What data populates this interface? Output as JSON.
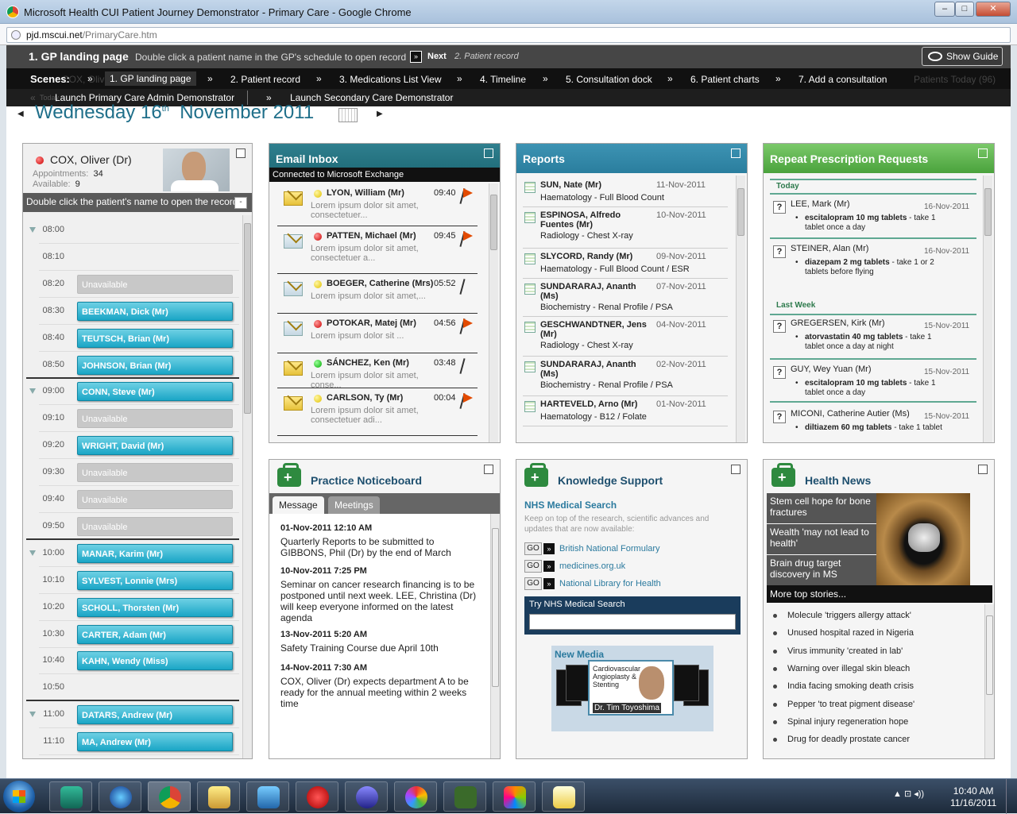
{
  "window": {
    "title": "Microsoft Health CUI Patient Journey Demonstrator - Primary Care - Google Chrome",
    "min": "–",
    "max": "□",
    "close": "✕"
  },
  "address": {
    "host": "pjd.mscui.net",
    "path": "/PrimaryCare.htm"
  },
  "guide": {
    "step": "1. GP landing page",
    "instruction": "Double click a patient name in the GP's schedule to open record",
    "next_arrow": "»",
    "next_label": "Next",
    "next_step": "2. Patient record",
    "show_guide": "Show Guide"
  },
  "scenes": {
    "label": "Scenes:",
    "ghost_left": "COX, Oliver",
    "ghost_right": "Patients Today (96)",
    "sep": "»",
    "items": [
      "1. GP landing page",
      "2. Patient record",
      "3. Medications List View",
      "4. Timeline",
      "5. Consultation dock",
      "6. Patient charts",
      "7. Add a consultation"
    ]
  },
  "demos": {
    "left": "Launch Primary Care Admin Demonstrator",
    "right": "Launch Secondary Care Demonstrator",
    "arrow": "«",
    "arrow_r": "»",
    "ghost": "Today"
  },
  "date": {
    "weekday": "Wednesday 16",
    "suffix": "th",
    "month_year": "November 2011",
    "prev": "◀",
    "next": "▶"
  },
  "schedule": {
    "doctor": "COX, Oliver (Dr)",
    "appointments_label": "Appointments:",
    "appointments": "34",
    "available_label": "Available:",
    "available": "9",
    "hint": "Double click the patient's name to open the record",
    "collapse": "-",
    "slots": [
      {
        "time": "08:00",
        "hour": true,
        "appt": "",
        "kind": ""
      },
      {
        "time": "08:10",
        "hour": false,
        "appt": "",
        "kind": ""
      },
      {
        "time": "08:20",
        "hour": false,
        "appt": "Unavailable",
        "kind": "un"
      },
      {
        "time": "08:30",
        "hour": false,
        "appt": "BEEKMAN, Dick (Mr)",
        "kind": "book"
      },
      {
        "time": "08:40",
        "hour": false,
        "appt": "TEUTSCH, Brian (Mr)",
        "kind": "book"
      },
      {
        "time": "08:50",
        "hour": false,
        "appt": "JOHNSON, Brian (Mr)",
        "kind": "book"
      },
      {
        "time": "09:00",
        "hour": true,
        "appt": "CONN, Steve (Mr)",
        "kind": "book"
      },
      {
        "time": "09:10",
        "hour": false,
        "appt": "Unavailable",
        "kind": "un"
      },
      {
        "time": "09:20",
        "hour": false,
        "appt": "WRIGHT, David (Mr)",
        "kind": "book"
      },
      {
        "time": "09:30",
        "hour": false,
        "appt": "Unavailable",
        "kind": "un"
      },
      {
        "time": "09:40",
        "hour": false,
        "appt": "Unavailable",
        "kind": "un"
      },
      {
        "time": "09:50",
        "hour": false,
        "appt": "Unavailable",
        "kind": "un"
      },
      {
        "time": "10:00",
        "hour": true,
        "appt": "MANAR, Karim (Mr)",
        "kind": "book"
      },
      {
        "time": "10:10",
        "hour": false,
        "appt": "SYLVEST, Lonnie (Mrs)",
        "kind": "book"
      },
      {
        "time": "10:20",
        "hour": false,
        "appt": "SCHOLL, Thorsten (Mr)",
        "kind": "book"
      },
      {
        "time": "10:30",
        "hour": false,
        "appt": "CARTER, Adam (Mr)",
        "kind": "book"
      },
      {
        "time": "10:40",
        "hour": false,
        "appt": "KAHN, Wendy (Miss)",
        "kind": "book"
      },
      {
        "time": "10:50",
        "hour": false,
        "appt": "",
        "kind": ""
      },
      {
        "time": "11:00",
        "hour": true,
        "appt": "DATARS, Andrew (Mr)",
        "kind": "book"
      },
      {
        "time": "11:10",
        "hour": false,
        "appt": "MA, Andrew (Mr)",
        "kind": "book"
      }
    ]
  },
  "email": {
    "title": "Email Inbox",
    "subtitle": "Connected to Microsoft Exchange",
    "items": [
      {
        "name": "LYON, William (Mr)",
        "time": "09:40",
        "body": "Lorem ipsum dolor sit amet, consectetuer...",
        "dot": "y",
        "flag": true,
        "open": false
      },
      {
        "name": "PATTEN, Michael (Mr)",
        "time": "09:45",
        "body": "Lorem ipsum dolor sit amet, consectetuer a...",
        "dot": "r",
        "flag": true,
        "open": true
      },
      {
        "name": "BOEGER, Catherine (Mrs)",
        "time": "05:52",
        "body": "Lorem ipsum dolor sit amet,...",
        "dot": "y",
        "flag": false,
        "open": true
      },
      {
        "name": "POTOKAR, Matej (Mr)",
        "time": "04:56",
        "body": "Lorem ipsum dolor sit ...",
        "dot": "r",
        "flag": true,
        "open": true
      },
      {
        "name": "SÁNCHEZ, Ken (Mr)",
        "time": "03:48",
        "body": "Lorem ipsum dolor sit amet, conse...",
        "dot": "g",
        "flag": false,
        "open": false
      },
      {
        "name": "CARLSON, Ty (Mr)",
        "time": "00:04",
        "body": "Lorem ipsum dolor sit amet, consectetuer adi...",
        "dot": "y",
        "flag": true,
        "open": false
      }
    ]
  },
  "reports": {
    "title": "Reports",
    "items": [
      {
        "name": "SUN, Nate (Mr)",
        "date": "11-Nov-2011",
        "desc": "Haematology - Full Blood Count",
        "lines": 1
      },
      {
        "name": "ESPINOSA, Alfredo Fuentes (Mr)",
        "date": "10-Nov-2011",
        "desc": "Radiology - Chest X-ray",
        "lines": 2
      },
      {
        "name": "SLYCORD, Randy (Mr)",
        "date": "09-Nov-2011",
        "desc": "Haematology - Full Blood Count / ESR",
        "lines": 1
      },
      {
        "name": "SUNDARARAJ, Ananth (Ms)",
        "date": "07-Nov-2011",
        "desc": "Biochemistry - Renal Profile / PSA",
        "lines": 2
      },
      {
        "name": "GESCHWANDTNER, Jens (Mr)",
        "date": "04-Nov-2011",
        "desc": "Radiology - Chest X-ray",
        "lines": 2
      },
      {
        "name": "SUNDARARAJ, Ananth (Ms)",
        "date": "02-Nov-2011",
        "desc": "Biochemistry - Renal Profile / PSA",
        "lines": 2
      },
      {
        "name": "HARTEVELD, Arno (Mr)",
        "date": "01-Nov-2011",
        "desc": "Haematology - B12 / Folate",
        "lines": 1
      }
    ]
  },
  "repeat": {
    "title": "Repeat Prescription Requests",
    "today": "Today",
    "last_week": "Last Week",
    "q": "?",
    "bullet": "•",
    "items": [
      {
        "name": "LEE, Mark (Mr)",
        "date": "16-Nov-2011",
        "drug": "escitalopram 10 mg tablets",
        "dose": " - take 1 tablet once a day"
      },
      {
        "name": "STEINER, Alan (Mr)",
        "date": "16-Nov-2011",
        "drug": "diazepam 2 mg tablets",
        "dose": " -  take 1 or 2 tablets before flying"
      },
      {
        "name": "GREGERSEN, Kirk (Mr)",
        "date": "15-Nov-2011",
        "drug": "atorvastatin 40 mg tablets",
        "dose": " - take 1 tablet once a day at night"
      },
      {
        "name": "GUY, Wey Yuan (Mr)",
        "date": "15-Nov-2011",
        "drug": "escitalopram 10 mg tablets",
        "dose": " - take 1 tablet once a day"
      },
      {
        "name": "MICONI, Catherine Autier (Ms)",
        "date": "15-Nov-2011",
        "drug": "diltiazem 60 mg tablets",
        "dose": " - take 1 tablet"
      }
    ]
  },
  "notice": {
    "title": "Practice Noticeboard",
    "tab_message": "Message",
    "tab_meetings": "Meetings",
    "items": [
      {
        "date": "01-Nov-2011 12:10 AM",
        "text": "Quarterly Reports to be submitted to GIBBONS, Phil (Dr) by the end of March"
      },
      {
        "date": "10-Nov-2011 7:25 PM",
        "text": "Seminar on cancer research financing is to be postponed until next week. LEE, Christina (Dr) will keep everyone informed on the latest agenda"
      },
      {
        "date": "13-Nov-2011 5:20 AM",
        "text": "Safety Training Course due April 10th"
      },
      {
        "date": "14-Nov-2011 7:30 AM",
        "text": "COX, Oliver (Dr) expects department A to be ready for the annual meeting within 2 weeks time"
      }
    ]
  },
  "knowledge": {
    "title": "Knowledge Support",
    "nhs": "NHS Medical Search",
    "blurb": "Keep on top of the research, scientific advances and updates that are now available:",
    "go": "GO",
    "go_arrow": "»",
    "links": [
      "British National Formulary",
      "medicines.org.uk",
      "National Library for Health"
    ],
    "try": "Try NHS Medical Search",
    "media_title": "New Media",
    "video_title": "Cardiovascular Angioplasty & Stenting",
    "video_doctor": "Dr. Tim Toyoshima"
  },
  "news": {
    "title": "Health News",
    "stories": [
      "Stem cell hope for bone fractures",
      "Wealth 'may not lead to health'",
      "Brain drug target discovery in MS"
    ],
    "more": "More top stories...",
    "items": [
      "Molecule 'triggers allergy attack'",
      "Unused hospital razed in Nigeria",
      "Virus immunity 'created in lab'",
      "Warning over illegal skin bleach",
      "India facing smoking death crisis",
      "Pepper 'to treat pigment disease'",
      "Spinal injury regeneration hope",
      "Drug for deadly prostate cancer"
    ]
  },
  "taskbar": {
    "time": "10:40 AM",
    "date": "11/16/2011",
    "tray": "▲  ⊡  ◂))"
  }
}
